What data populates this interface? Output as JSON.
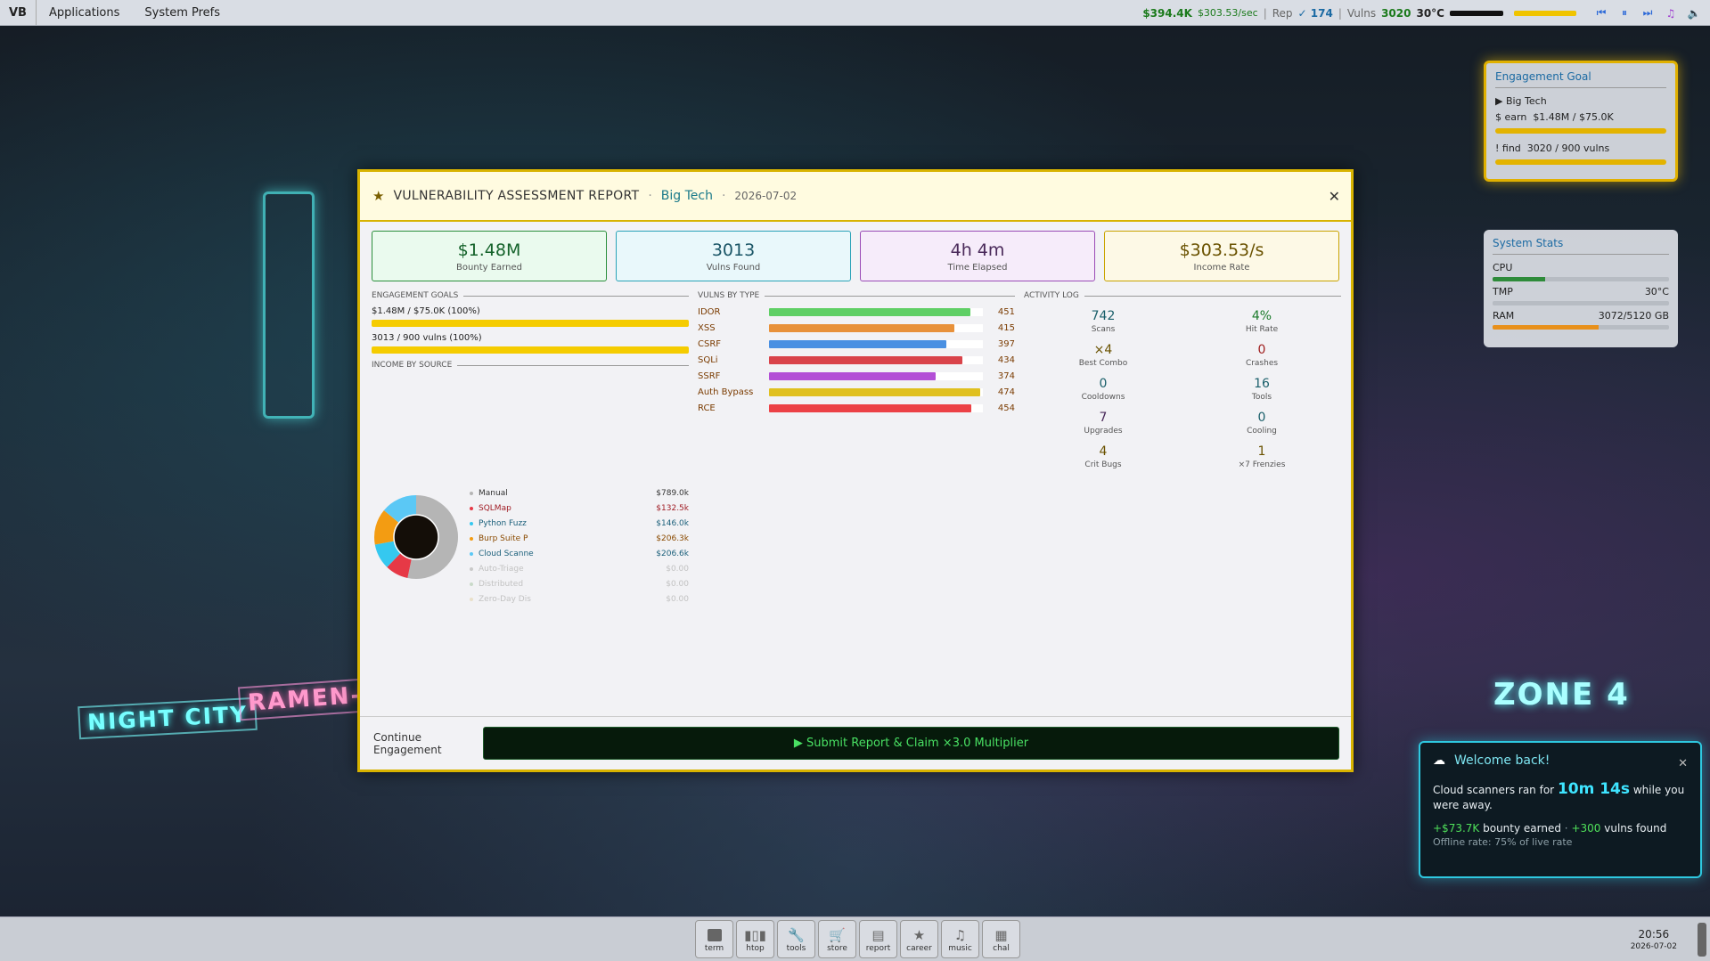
{
  "topbar": {
    "logo": "VB",
    "menus": [
      "Applications",
      "System Prefs"
    ],
    "money": "$394.4K",
    "rate": "$303.53/sec",
    "rep_label": "Rep",
    "rep_value": "✓ 174",
    "vulns_label": "Vulns",
    "vulns_value": "3020",
    "temp": "30°C"
  },
  "goal_widget": {
    "title": "Engagement Goal",
    "target": "▶ Big Tech",
    "earn_label": "$  earn",
    "earn_value": "$1.48M / $75.0K",
    "find_label": "!  find",
    "find_value": "3020 / 900 vulns"
  },
  "stats_widget": {
    "title": "System Stats",
    "cpu_label": "CPU",
    "cpu_pct": 0.3,
    "tmp_label": "TMP",
    "tmp_value": "30°C",
    "ram_label": "RAM",
    "ram_value": "3072/5120 GB",
    "ram_pct": 0.6
  },
  "modal": {
    "title": "VULNERABILITY ASSESSMENT REPORT",
    "company": "Big Tech",
    "date": "2026-07-02",
    "cards": [
      {
        "value": "$1.48M",
        "label": "Bounty Earned"
      },
      {
        "value": "3013",
        "label": "Vulns Found"
      },
      {
        "value": "4h 4m",
        "label": "Time Elapsed"
      },
      {
        "value": "$303.53/s",
        "label": "Income Rate"
      }
    ],
    "goals_title": "ENGAGEMENT GOALS",
    "goal1": "$1.48M / $75.0K  (100%)",
    "goal2": "3013 / 900 vulns  (100%)",
    "income_title": "INCOME BY SOURCE",
    "vulns_title": "VULNS BY TYPE",
    "activity_title": "ACTIVITY LOG",
    "continue_label": "Continue Engagement",
    "submit_label": "▶  Submit Report & Claim ×3.0 Multiplier"
  },
  "income_sources": [
    {
      "name": "Manual",
      "value": "$789.0k",
      "color": "#b5b5b5",
      "amount": 789.0,
      "active": true
    },
    {
      "name": "SQLMap",
      "value": "$132.5k",
      "color": "#e63946",
      "amount": 132.5,
      "active": true
    },
    {
      "name": "Python Fuzz",
      "value": "$146.0k",
      "color": "#35c8f0",
      "amount": 146.0,
      "active": true
    },
    {
      "name": "Burp Suite P",
      "value": "$206.3k",
      "color": "#f39c12",
      "amount": 206.3,
      "active": true
    },
    {
      "name": "Cloud Scanne",
      "value": "$206.6k",
      "color": "#5bc8f5",
      "amount": 206.6,
      "active": true
    },
    {
      "name": "Auto-Triage",
      "value": "$0.00",
      "color": "#c9c9c9",
      "amount": 0,
      "active": false
    },
    {
      "name": "Distributed",
      "value": "$0.00",
      "color": "#c9d9c9",
      "amount": 0,
      "active": false
    },
    {
      "name": "Zero-Day Dis",
      "value": "$0.00",
      "color": "#e9e0c9",
      "amount": 0,
      "active": false
    }
  ],
  "vulns_by_type": [
    {
      "name": "IDOR",
      "count": 451,
      "color": "#5fcf65"
    },
    {
      "name": "XSS",
      "count": 415,
      "color": "#e8913a"
    },
    {
      "name": "CSRF",
      "count": 397,
      "color": "#4a90e2"
    },
    {
      "name": "SQLi",
      "count": 434,
      "color": "#d9434a"
    },
    {
      "name": "SSRF",
      "count": 374,
      "color": "#b34fd6"
    },
    {
      "name": "Auth Bypass",
      "count": 474,
      "color": "#e0c020"
    },
    {
      "name": "RCE",
      "count": 454,
      "color": "#ec4146"
    }
  ],
  "activity": [
    {
      "value": "742",
      "label": "Scans",
      "color": "#1a5f6a"
    },
    {
      "value": "4%",
      "label": "Hit Rate",
      "color": "#1b7a2a"
    },
    {
      "value": "×4",
      "label": "Best Combo",
      "color": "#6a5200"
    },
    {
      "value": "0",
      "label": "Crashes",
      "color": "#a02020"
    },
    {
      "value": "0",
      "label": "Cooldowns",
      "color": "#1a5f6a"
    },
    {
      "value": "16",
      "label": "Tools",
      "color": "#1a5f6a"
    },
    {
      "value": "7",
      "label": "Upgrades",
      "color": "#4a2a5a"
    },
    {
      "value": "0",
      "label": "Cooling",
      "color": "#1a5f6a"
    },
    {
      "value": "4",
      "label": "Crit Bugs",
      "color": "#6a5200"
    },
    {
      "value": "1",
      "label": "×7 Frenzies",
      "color": "#6a5200"
    }
  ],
  "toast": {
    "title": "Welcome back!",
    "body_prefix": "Cloud scanners ran for",
    "duration": "10m 14s",
    "body_suffix": "while you were away.",
    "earned": "+$73.7K",
    "earned_label": "bounty earned",
    "dot": "·",
    "vulns": "+300",
    "vulns_label": "vulns found",
    "offline": "Offline rate: 75% of live rate"
  },
  "dock": [
    {
      "label": "term",
      "icon": "terminal-icon"
    },
    {
      "label": "htop",
      "icon": "chart-icon"
    },
    {
      "label": "tools",
      "icon": "wrench-icon"
    },
    {
      "label": "store",
      "icon": "cart-icon"
    },
    {
      "label": "report",
      "icon": "document-icon"
    },
    {
      "label": "career",
      "icon": "star-icon"
    },
    {
      "label": "music",
      "icon": "music-icon"
    },
    {
      "label": "chal",
      "icon": "grid-icon"
    }
  ],
  "clock": {
    "time": "20:56",
    "date": "2026-07-02"
  },
  "background_signs": [
    "NIGHT CITY",
    "RAMEN-YA",
    "ZONE 4"
  ]
}
